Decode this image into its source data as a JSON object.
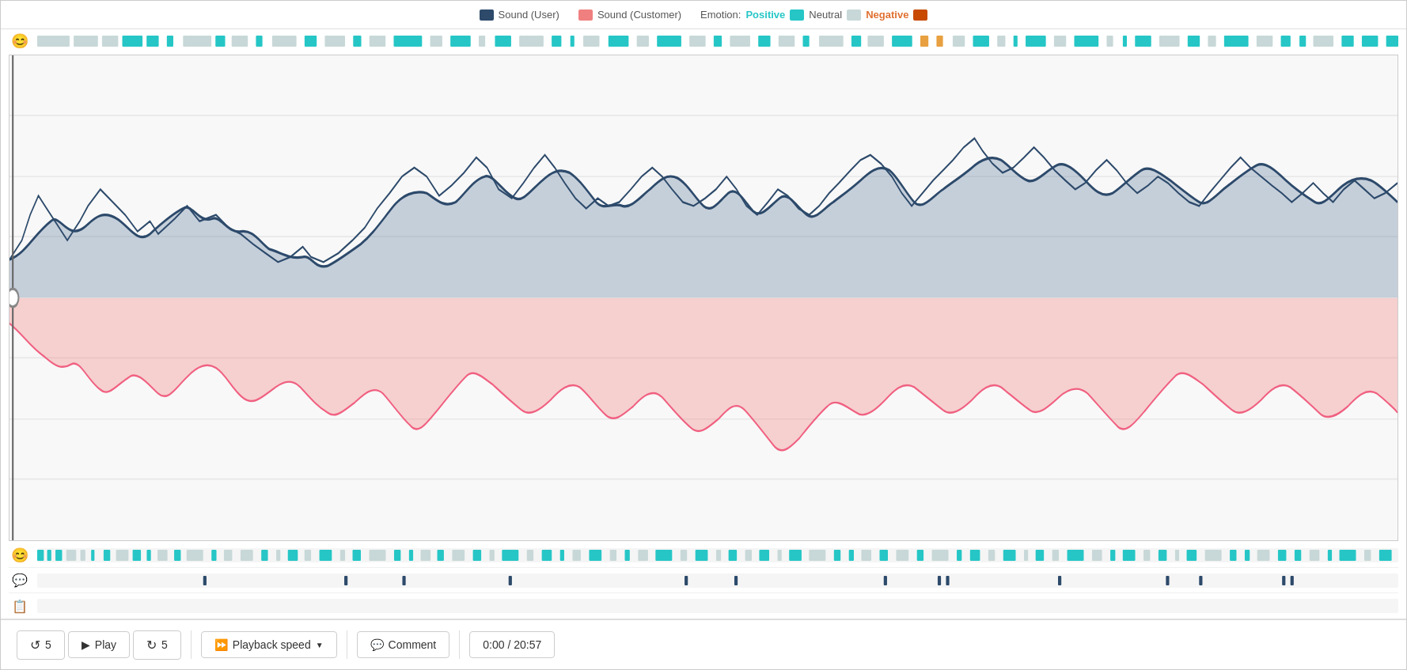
{
  "legend": {
    "sound_user_label": "Sound (User)",
    "sound_customer_label": "Sound (Customer)",
    "emotion_label": "Emotion:",
    "positive_label": "Positive",
    "neutral_label": "Neutral",
    "negative_label": "Negative",
    "colors": {
      "user": "#2d4a6b",
      "customer": "#f08080",
      "positive": "#26c6c6",
      "neutral": "#c8d8d8",
      "negative_text": "#e07030",
      "negative_swatch": "#c84a00"
    }
  },
  "tracks": {
    "top_emotion_icon": "😊",
    "bottom_emotion_icon": "😊",
    "chat_icon": "💬",
    "note_icon": "📋"
  },
  "controls": {
    "rewind_label": "5",
    "play_label": "Play",
    "forward_label": "5",
    "playback_speed_label": "Playback speed",
    "comment_label": "Comment",
    "time_current": "0:00",
    "time_total": "20:57"
  }
}
